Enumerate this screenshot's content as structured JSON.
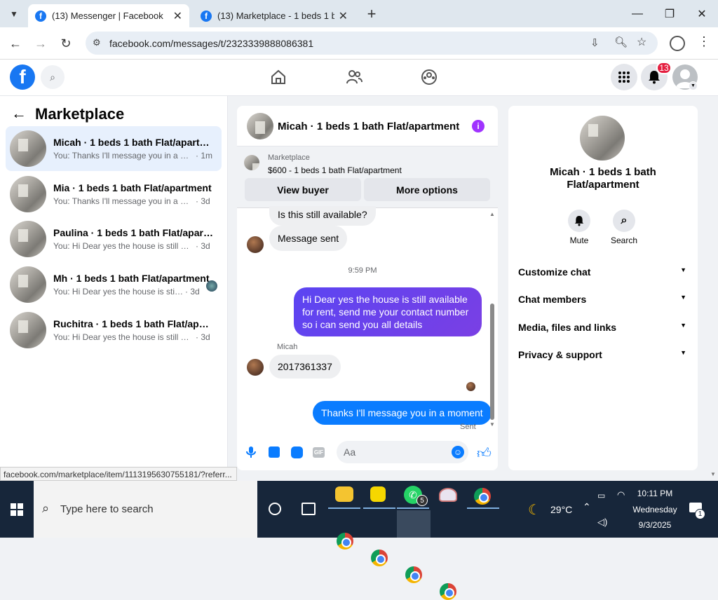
{
  "browser": {
    "tabs": [
      {
        "title": "(13) Messenger | Facebook",
        "close": "✕"
      },
      {
        "title": "(13) Marketplace - 1 beds 1 bat",
        "close": "✕"
      }
    ],
    "new_tab": "+",
    "url": "facebook.com/messages/t/2323339888086381",
    "status_url": "facebook.com/marketplace/item/1113195630755181/?referr..."
  },
  "fb_header": {
    "notification_count": "13",
    "icons": [
      "facebook-logo",
      "search-icon",
      "home-icon",
      "friends-icon",
      "groups-icon",
      "menu-grid-icon",
      "bell-icon",
      "profile-icon"
    ]
  },
  "left": {
    "title": "Marketplace",
    "conversations": [
      {
        "name": "Micah · 1 beds 1 bath Flat/apartment",
        "snippet": "You: Thanks I'll message you in a mo...",
        "time": "· 1m"
      },
      {
        "name": "Mia · 1 beds 1 bath Flat/apartment",
        "snippet": "You: Thanks I'll message you in a mo...",
        "time": "· 3d"
      },
      {
        "name": "Paulina · 1 beds 1 bath Flat/apartm...",
        "snippet": "You: Hi Dear yes the house is still avail...",
        "time": "· 3d"
      },
      {
        "name": "Mh · 1 beds 1 bath Flat/apartment",
        "snippet": "You: Hi Dear yes the house is still a...",
        "time": "· 3d"
      },
      {
        "name": "Ruchitra · 1 beds 1 bath Flat/apart...",
        "snippet": "You: Hi Dear yes the house is still avail...",
        "time": "· 3d"
      }
    ]
  },
  "chat": {
    "title": "Micah · 1 beds 1 bath Flat/apartment",
    "listing_source": "Marketplace",
    "listing": "$600 - 1 beds 1 bath Flat/apartment",
    "view_buyer": "View buyer",
    "more_options": "More options",
    "messages": {
      "m1": "Is this still available?",
      "m2": "Message sent",
      "timestamp": "9:59 PM",
      "m3": "Hi Dear yes the house is still available for rent, send me your contact number so i can send you all details",
      "sender": "Micah",
      "m4": "2017361337",
      "m5": "Thanks I'll message you in a moment",
      "status": "Sent"
    },
    "input_placeholder": "Aa"
  },
  "right": {
    "title": "Micah · 1 beds 1 bath Flat/apartment",
    "mute": "Mute",
    "search": "Search",
    "sections": [
      "Customize chat",
      "Chat members",
      "Media, files and links",
      "Privacy & support"
    ]
  },
  "taskbar": {
    "search_placeholder": "Type here to search",
    "whatsapp_badge": "5",
    "weather": "29°C",
    "time": "10:11 PM",
    "day": "Wednesday",
    "date": "9/3/2025",
    "notif_badge": "1"
  }
}
